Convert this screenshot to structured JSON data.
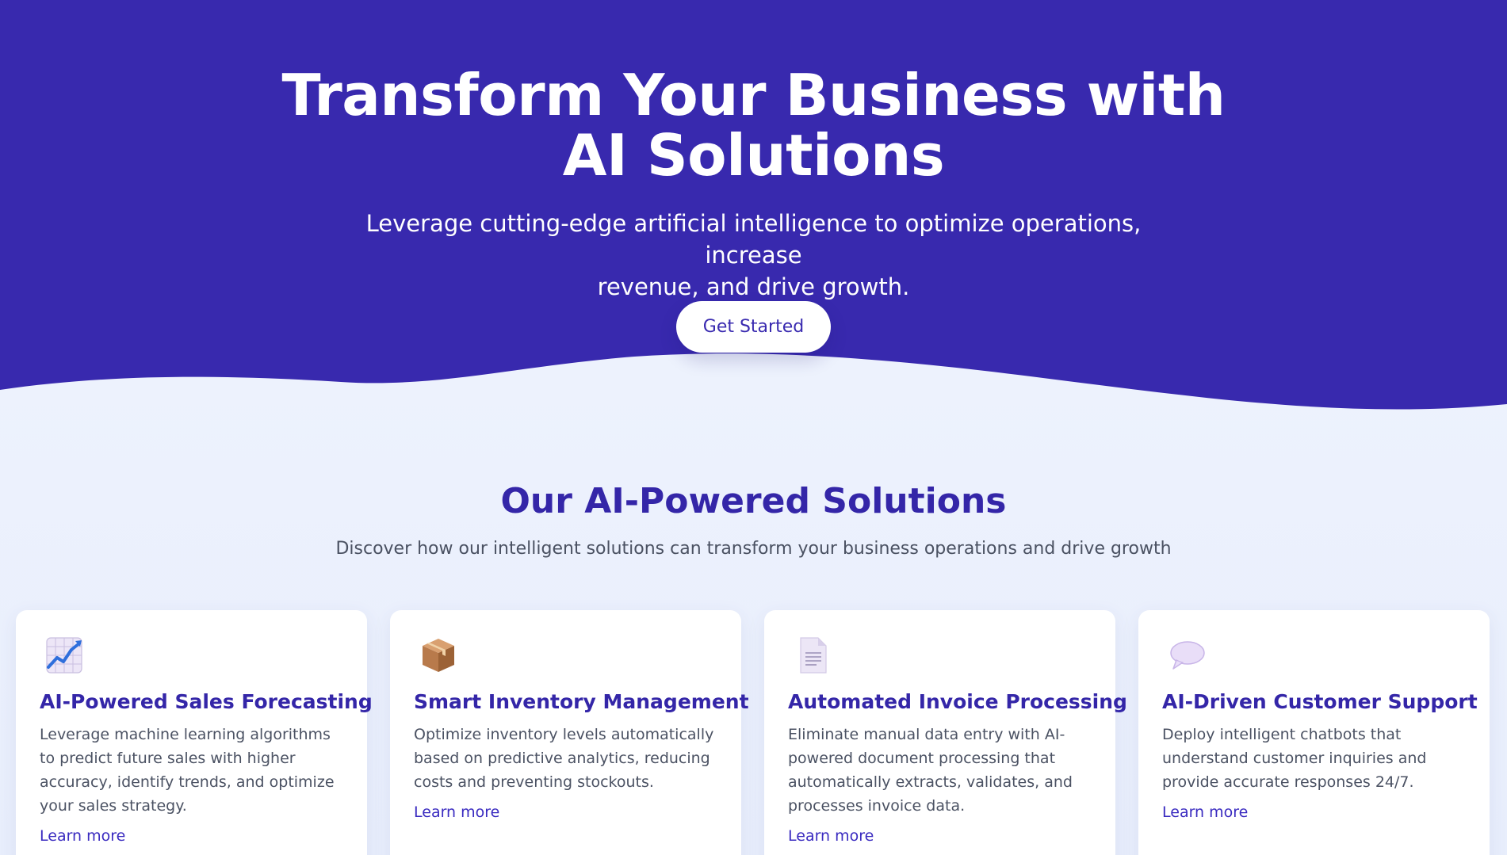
{
  "hero": {
    "title_line1": "Transform Your Business with",
    "title_line2": "AI Solutions",
    "subtitle_line1": "Leverage cutting-edge artificial intelligence to optimize operations, increase",
    "subtitle_line2": "revenue, and drive growth.",
    "cta_label": "Get Started"
  },
  "solutions": {
    "title": "Our AI-Powered Solutions",
    "subtitle": "Discover how our intelligent solutions can transform your business operations and drive growth",
    "cards": [
      {
        "icon": "chart-increasing-icon",
        "title": "AI-Powered Sales Forecasting",
        "description": "Leverage machine learning algorithms to predict future sales with higher accuracy, identify trends, and optimize your sales strategy.",
        "link": "Learn more"
      },
      {
        "icon": "package-box-icon",
        "title": "Smart Inventory Management",
        "description": "Optimize inventory levels automatically based on predictive analytics, reducing costs and preventing stockouts.",
        "link": "Learn more"
      },
      {
        "icon": "document-icon",
        "title": "Automated Invoice Processing",
        "description": "Eliminate manual data entry with AI-powered document processing that automatically extracts, validates, and processes invoice data.",
        "link": "Learn more"
      },
      {
        "icon": "speech-bubble-icon",
        "title": "AI-Driven Customer Support",
        "description": "Deploy intelligent chatbots that understand customer inquiries and provide accurate responses 24/7.",
        "link": "Learn more"
      }
    ]
  },
  "colors": {
    "hero_bg": "#3829ae",
    "accent": "#3426a8",
    "page_bg": "#eef2fd",
    "card_bg": "#ffffff"
  }
}
